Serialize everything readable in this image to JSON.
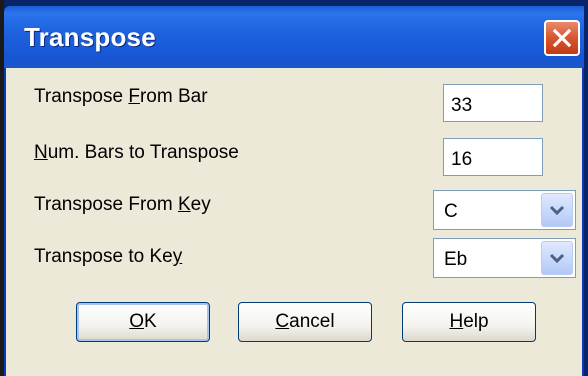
{
  "window": {
    "title": "Transpose"
  },
  "fields": {
    "from_bar": {
      "label_before": "Transpose ",
      "label_key": "F",
      "label_after": "rom Bar",
      "value": "33"
    },
    "num_bars": {
      "label_before": "",
      "label_key": "N",
      "label_after": "um. Bars to Transpose",
      "value": "16"
    },
    "from_key": {
      "label_before": "Transpose From ",
      "label_key": "K",
      "label_after": "ey",
      "value": "C"
    },
    "to_key": {
      "label_before": "Transpose to Ke",
      "label_key": "y",
      "label_after": "",
      "value": "Eb"
    }
  },
  "buttons": {
    "ok": {
      "key": "O",
      "rest": "K"
    },
    "cancel": {
      "key": "C",
      "rest": "ancel"
    },
    "help": {
      "key": "H",
      "rest": "elp"
    }
  },
  "colors": {
    "titlebar": "#1d61df",
    "client": "#ece9d8",
    "close": "#d7552f"
  }
}
